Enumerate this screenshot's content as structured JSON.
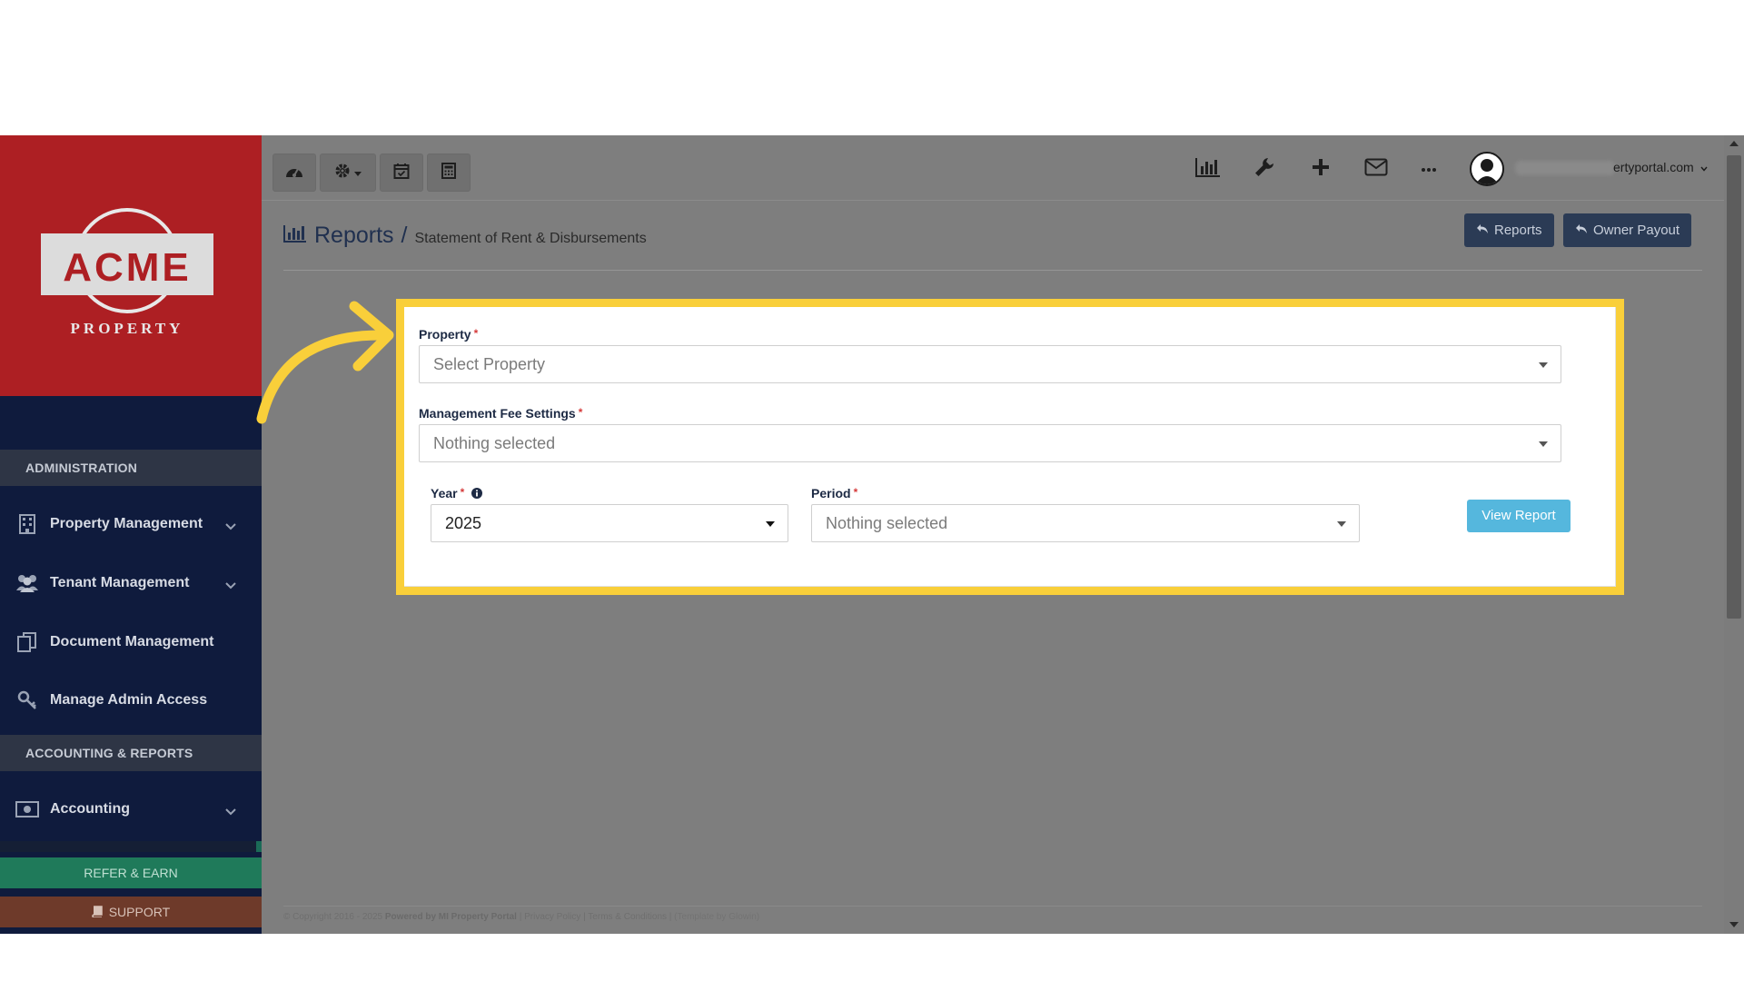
{
  "brand": {
    "logo_top": "ACME",
    "logo_bottom": "PROPERTY"
  },
  "sidebar": {
    "heading_admin": "ADMINISTRATION",
    "heading_accounting": "ACCOUNTING & REPORTS",
    "items": [
      {
        "label": "Property Management",
        "icon": "building-icon",
        "has_chevron": true
      },
      {
        "label": "Tenant Management",
        "icon": "users-icon",
        "has_chevron": true
      },
      {
        "label": "Document Management",
        "icon": "documents-icon",
        "has_chevron": false
      },
      {
        "label": "Manage Admin Access",
        "icon": "key-icon",
        "has_chevron": false
      },
      {
        "label": "Accounting",
        "icon": "money-icon",
        "has_chevron": true
      }
    ],
    "refer_label": "REFER & EARN",
    "support_label": "SUPPORT"
  },
  "topbar": {
    "left_buttons": [
      "dashboard-icon",
      "settings-icon",
      "calendar-icon",
      "calculator-icon"
    ],
    "right_icons": [
      "bar-chart-icon",
      "wrench-icon",
      "plus-icon",
      "mail-icon",
      "more-icon"
    ],
    "user_email_visible": "ertyportal.com"
  },
  "page": {
    "title": "Reports",
    "separator": "/",
    "subtitle": "Statement of Rent & Disbursements",
    "reports_button": "Reports",
    "owner_payout_button": "Owner Payout"
  },
  "form": {
    "property_label": "Property",
    "property_placeholder": "Select Property",
    "fee_label": "Management Fee Settings",
    "fee_value": "Nothing selected",
    "year_label": "Year",
    "year_value": "2025",
    "period_label": "Period",
    "period_value": "Nothing selected",
    "required_mark": "*",
    "view_button": "View Report"
  },
  "footer": {
    "copyright": "© Copyright 2016 - 2025",
    "powered": "Powered by MI Property Portal",
    "links": "| Privacy Policy | Terms & Conditions |",
    "template": "(Template by Glowin)"
  },
  "colors": {
    "sidebar_bg": "#0f1b3d",
    "logo_bg": "#ad1f23",
    "highlight": "#f9cf3a",
    "view_button": "#55b7dd",
    "header_button": "#2b3b55"
  }
}
